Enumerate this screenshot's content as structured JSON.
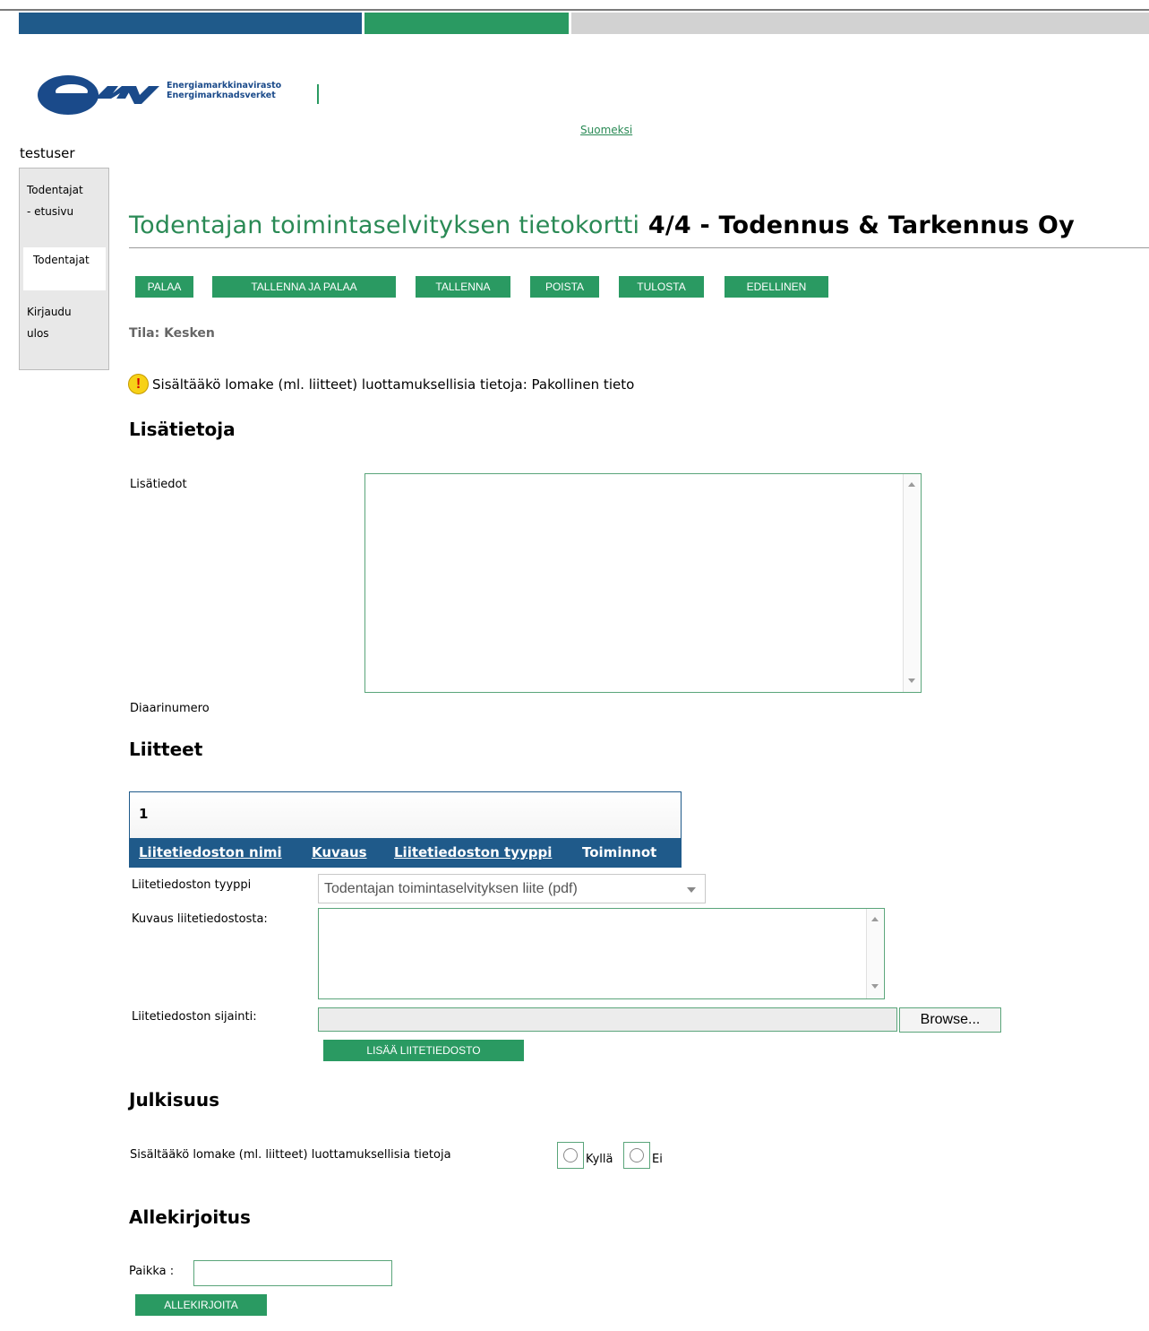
{
  "header": {
    "colors": {
      "blue": "#1f5a8a",
      "green": "#2a9a62",
      "gray": "#d2d2d2"
    },
    "logo_icon": "emv-logo",
    "org_name_fi": "Energiamarkkinavirasto",
    "org_name_sv": "Energimarknadsverket",
    "language_link": "Suomeksi",
    "username": "testuser"
  },
  "sidebar": {
    "items": [
      {
        "line1": "Todentajat",
        "line2": "- etusivu"
      },
      {
        "line1": "Todentajat",
        "line2": ""
      },
      {
        "line1": "Kirjaudu",
        "line2": "ulos"
      }
    ]
  },
  "main": {
    "title_green": "Todentajan toimintaselvityksen tietokortti",
    "title_dark": "4/4 - Todennus & Tarkennus Oy",
    "buttons": [
      "PALAA",
      "TALLENNA JA PALAA",
      "TALLENNA",
      "POISTA",
      "TULOSTA",
      "EDELLINEN"
    ],
    "status": "Tila: Kesken",
    "warning_icon": "exclamation-icon",
    "warning": "Sisältääkö lomake (ml. liitteet) luottamuksellisia tietoja: Pakollinen tieto"
  },
  "lisatietoja": {
    "heading": "Lisätietoja",
    "field_label": "Lisätiedot",
    "field_value": "",
    "diaari_label": "Diaarinumero"
  },
  "liitteet": {
    "heading": "Liitteet",
    "page_number": "1",
    "columns": [
      "Liitetiedoston nimi",
      "Kuvaus",
      "Liitetiedoston tyyppi",
      "Toiminnot"
    ],
    "type_label": "Liitetiedoston tyyppi",
    "type_value": "Todentajan toimintaselvityksen liite (pdf)",
    "desc_label": "Kuvaus liitetiedostosta:",
    "location_label": "Liitetiedoston sijainti:",
    "browse_label": "Browse...",
    "add_label": "LISÄÄ LIITETIEDOSTO"
  },
  "julkisuus": {
    "heading": "Julkisuus",
    "question": "Sisältääkö lomake (ml. liitteet) luottamuksellisia tietoja",
    "option_yes": "Kyllä",
    "option_no": "Ei"
  },
  "allekirjoitus": {
    "heading": "Allekirjoitus",
    "place_label": "Paikka :",
    "place_value": "",
    "sign_label": "ALLEKIRJOITA"
  }
}
